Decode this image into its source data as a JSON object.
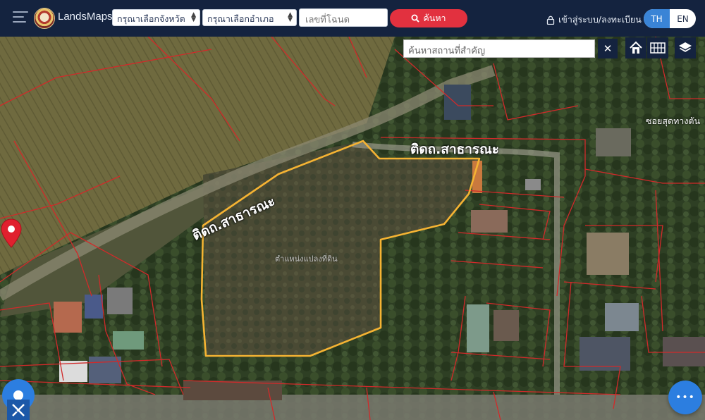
{
  "app": {
    "brand": "LandsMaps"
  },
  "header": {
    "province_select": "กรุณาเลือกจังหวัด",
    "district_select": "กรุณาเลือกอำเภอ",
    "deed_placeholder": "เลขที่โฉนด",
    "search_label": "ค้นหา",
    "login_label": "เข้าสู่ระบบ/ลงทะเบียน",
    "lang_th": "TH",
    "lang_en": "EN",
    "active_lang": "TH"
  },
  "map_tools": {
    "place_search_placeholder": "ค้นหาสถานที่สำคัญ",
    "close_symbol": "✕",
    "icons": [
      "home-icon",
      "grid-icon",
      "layers-icon"
    ]
  },
  "map_labels": {
    "road_top": "ติดถ.สาธารณะ",
    "road_left": "ติดถ.สาธารณะ",
    "soi": "ซอยสุดทางตัน",
    "pin_label": "ตำแหน่งแปลงที่ดิน"
  },
  "fab": {
    "more_symbol": "•••"
  },
  "colors": {
    "header_bg": "#14233f",
    "search_btn": "#e2313f",
    "lang_active": "#3a84d6",
    "parcel_outline": "#f5b333",
    "cadastral_lines": "#d12a2a",
    "pin": "#e0202e",
    "fab": "#2c7ee0"
  }
}
